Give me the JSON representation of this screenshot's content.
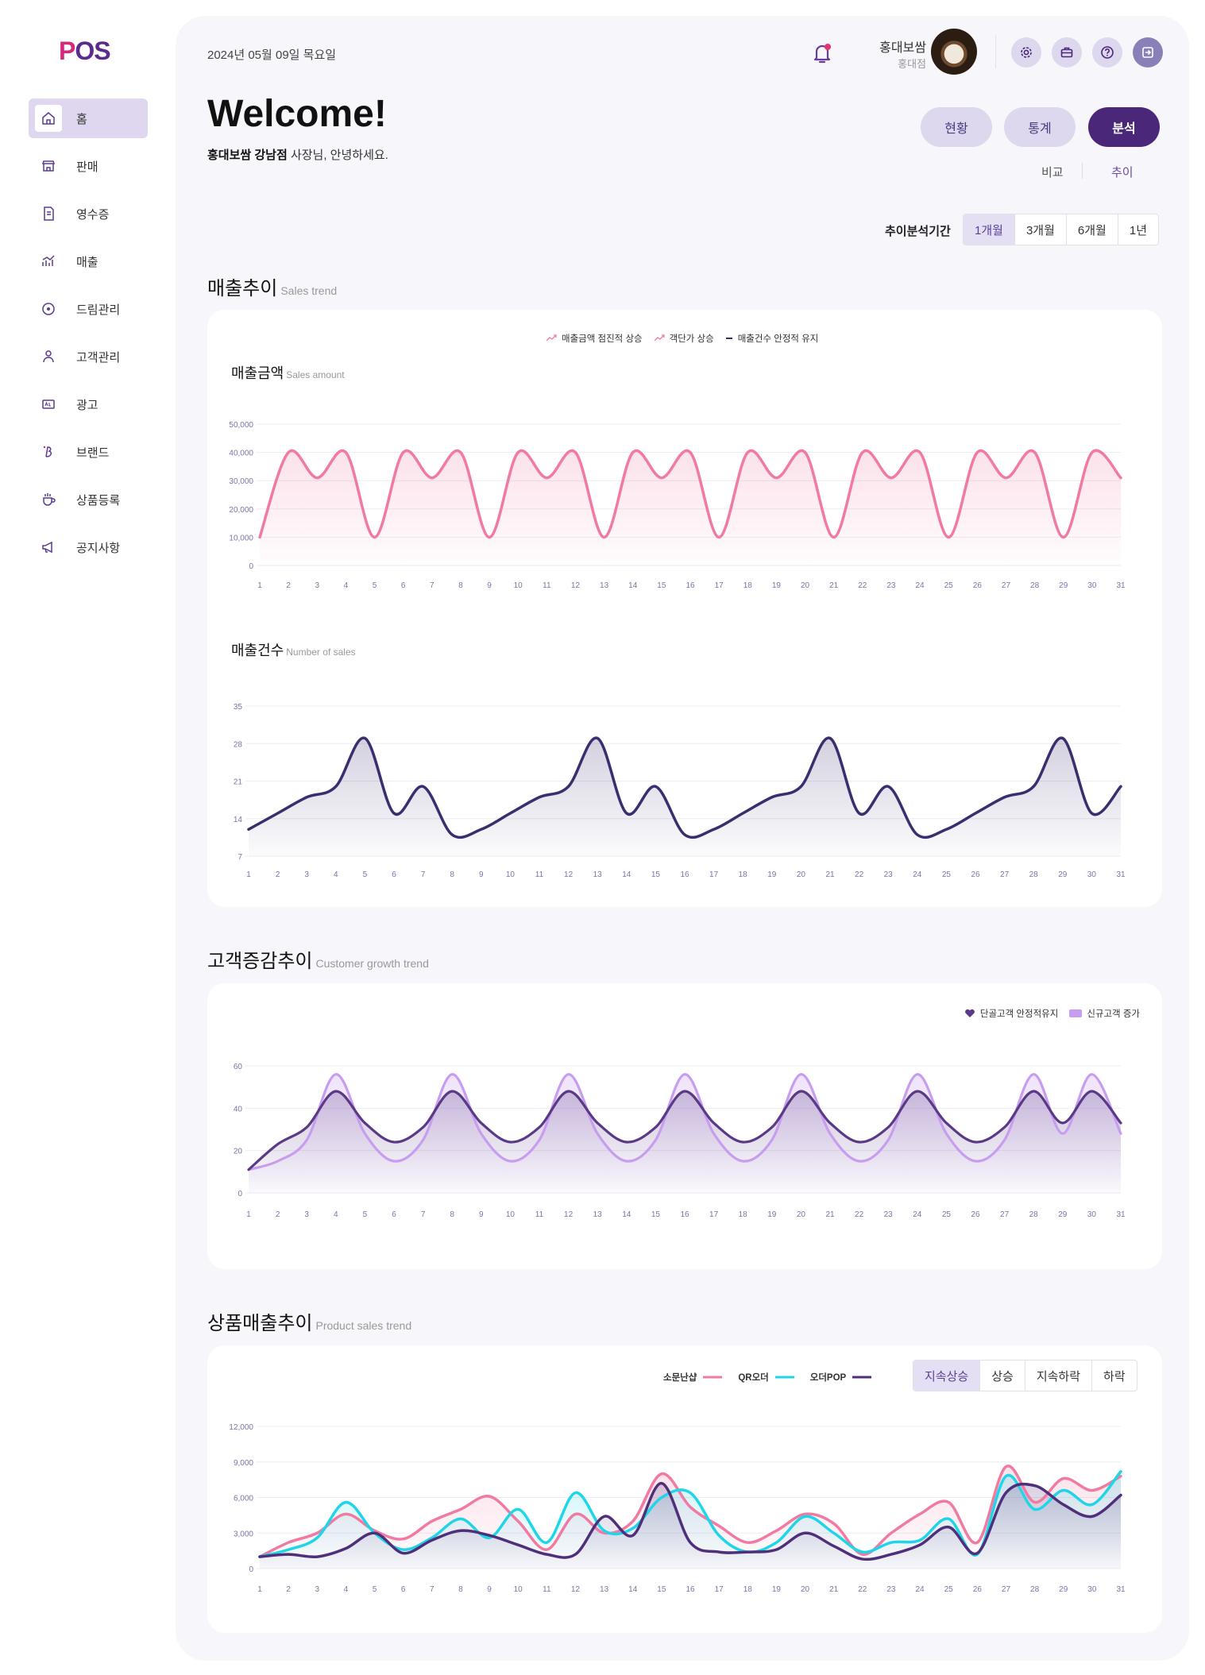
{
  "brand": {
    "logo_p": "P",
    "logo_rest": "OS",
    "accent": "#d6287a",
    "primary": "#4a2779"
  },
  "sidebar": {
    "items": [
      {
        "label": "홈",
        "icon": "home-icon",
        "active": true
      },
      {
        "label": "판매",
        "icon": "store-icon",
        "active": false
      },
      {
        "label": "영수증",
        "icon": "receipt-icon",
        "active": false
      },
      {
        "label": "매출",
        "icon": "trend-icon",
        "active": false
      },
      {
        "label": "드림관리",
        "icon": "coin-icon",
        "active": false
      },
      {
        "label": "고객관리",
        "icon": "person-icon",
        "active": false
      },
      {
        "label": "광고",
        "icon": "ad-icon",
        "active": false
      },
      {
        "label": "브랜드",
        "icon": "brand-icon",
        "active": false
      },
      {
        "label": "상품등록",
        "icon": "cup-icon",
        "active": false
      },
      {
        "label": "공지사항",
        "icon": "megaphone-icon",
        "active": false
      }
    ]
  },
  "header": {
    "date": "2024년 05월 09일 목요일",
    "user_name": "홍대보쌈",
    "user_store": "홍대점",
    "icons": [
      "gear-icon",
      "briefcase-icon",
      "help-icon",
      "logout-icon"
    ]
  },
  "welcome": {
    "title": "Welcome!",
    "store_bold": "홍대보쌈 강남점",
    "greeting_rest": " 사장님, 안녕하세요."
  },
  "view_tabs": [
    {
      "label": "현황",
      "active": false
    },
    {
      "label": "통계",
      "active": false
    },
    {
      "label": "분석",
      "active": true
    }
  ],
  "sub_tabs": [
    {
      "label": "비교",
      "active": false
    },
    {
      "label": "추이",
      "active": true
    }
  ],
  "period": {
    "label": "추이분석기간",
    "options": [
      {
        "label": "1개월",
        "active": true
      },
      {
        "label": "3개월",
        "active": false
      },
      {
        "label": "6개월",
        "active": false
      },
      {
        "label": "1년",
        "active": false
      }
    ]
  },
  "sections": {
    "sales": {
      "title": "매출추이",
      "en": "Sales trend"
    },
    "customer": {
      "title": "고객증감추이",
      "en": "Customer growth trend"
    },
    "product": {
      "title": "상품매출추이",
      "en": "Product sales trend"
    }
  },
  "sales_legend": [
    {
      "label": "매출금액 점진적 상승",
      "color": "#f07aa2",
      "marker": "trend-up"
    },
    {
      "label": "객단가 상승",
      "color": "#f07aa2",
      "marker": "trend-up"
    },
    {
      "label": "매출건수 안정적 유지",
      "color": "#3b2d6e",
      "marker": "dash"
    }
  ],
  "customer_legend": [
    {
      "label": "단골고객 안정적유지",
      "color": "#5a3a86",
      "marker": "heart"
    },
    {
      "label": "신규고객 증가",
      "color": "#c79df0",
      "marker": "new-badge"
    }
  ],
  "product_legend": [
    {
      "label": "소문난샵",
      "color": "#f07aa2"
    },
    {
      "label": "QR오더",
      "color": "#1fd6e8"
    },
    {
      "label": "오더POP",
      "color": "#4f2f7a"
    }
  ],
  "product_filter": [
    {
      "label": "지속상승",
      "active": true
    },
    {
      "label": "상승",
      "active": false
    },
    {
      "label": "지속하락",
      "active": false
    },
    {
      "label": "하락",
      "active": false
    }
  ],
  "chart_data": [
    {
      "id": "sales_amount",
      "type": "area",
      "title": "매출금액",
      "subtitle": "Sales amount",
      "x": [
        1,
        2,
        3,
        4,
        5,
        6,
        7,
        8,
        9,
        10,
        11,
        12,
        13,
        14,
        15,
        16,
        17,
        18,
        19,
        20,
        21,
        22,
        23,
        24,
        25,
        26,
        27,
        28,
        29,
        30,
        31
      ],
      "ylim": [
        0,
        50000
      ],
      "yticks": [
        0,
        10000,
        20000,
        30000,
        40000,
        50000
      ],
      "ytick_labels": [
        "0",
        "10,000",
        "20,000",
        "30,000",
        "40,000",
        "50,000"
      ],
      "grid": true,
      "series": [
        {
          "values": [
            10000,
            40000,
            31000,
            40000,
            10000,
            40000,
            31000,
            40000,
            10000,
            40000,
            31000,
            40000,
            10000,
            40000,
            31000,
            40000,
            10000,
            40000,
            31000,
            40000,
            10000,
            40000,
            31000,
            40000,
            10000,
            40000,
            31000,
            40000,
            10000,
            40000,
            31000
          ],
          "color": "#f07aa2"
        }
      ]
    },
    {
      "id": "sales_count",
      "type": "area",
      "title": "매출건수",
      "subtitle": "Number of sales",
      "x": [
        1,
        2,
        3,
        4,
        5,
        6,
        7,
        8,
        9,
        10,
        11,
        12,
        13,
        14,
        15,
        16,
        17,
        18,
        19,
        20,
        21,
        22,
        23,
        24,
        25,
        26,
        27,
        28,
        29,
        30,
        31
      ],
      "ylim": [
        7,
        35
      ],
      "yticks": [
        7,
        14,
        21,
        28,
        35
      ],
      "ytick_labels": [
        "7",
        "14",
        "21",
        "28",
        "35"
      ],
      "grid": true,
      "series": [
        {
          "values": [
            12,
            15,
            18,
            20,
            29,
            15,
            20,
            11,
            12,
            15,
            18,
            20,
            29,
            15,
            20,
            11,
            12,
            15,
            18,
            20,
            29,
            15,
            20,
            11,
            12,
            15,
            18,
            20,
            29,
            15,
            20
          ],
          "color": "#3b2d6e"
        }
      ]
    },
    {
      "id": "customer",
      "type": "area",
      "x": [
        1,
        2,
        3,
        4,
        5,
        6,
        7,
        8,
        9,
        10,
        11,
        12,
        13,
        14,
        15,
        16,
        17,
        18,
        19,
        20,
        21,
        22,
        23,
        24,
        25,
        26,
        27,
        28,
        29,
        30,
        31
      ],
      "ylim": [
        0,
        60
      ],
      "yticks": [
        0,
        20,
        40,
        60
      ],
      "ytick_labels": [
        "0",
        "20",
        "40",
        "60"
      ],
      "grid": true,
      "series": [
        {
          "values": [
            11,
            15,
            25,
            56,
            28,
            15,
            25,
            56,
            28,
            15,
            25,
            56,
            28,
            15,
            25,
            56,
            28,
            15,
            25,
            56,
            28,
            15,
            25,
            56,
            28,
            15,
            25,
            56,
            28,
            56,
            28
          ],
          "color": "#c79df0"
        },
        {
          "values": [
            11,
            23,
            31,
            48,
            33,
            24,
            31,
            48,
            33,
            24,
            31,
            48,
            33,
            24,
            31,
            48,
            33,
            24,
            31,
            48,
            33,
            24,
            31,
            48,
            33,
            24,
            31,
            48,
            33,
            48,
            33
          ],
          "color": "#5a3a86"
        }
      ]
    },
    {
      "id": "product",
      "type": "area",
      "x": [
        1,
        2,
        3,
        4,
        5,
        6,
        7,
        8,
        9,
        10,
        11,
        12,
        13,
        14,
        15,
        16,
        17,
        18,
        19,
        20,
        21,
        22,
        23,
        24,
        25,
        26,
        27,
        28,
        29,
        30,
        31
      ],
      "ylim": [
        0,
        12000
      ],
      "yticks": [
        0,
        3000,
        6000,
        9000,
        12000
      ],
      "ytick_labels": [
        "0",
        "3,000",
        "6,000",
        "9,000",
        "12,000"
      ],
      "grid": true,
      "series": [
        {
          "name": "소문난샵",
          "values": [
            1000,
            2200,
            3000,
            4600,
            3200,
            2500,
            4000,
            5000,
            6100,
            4000,
            1600,
            4600,
            3000,
            4000,
            8000,
            5200,
            3600,
            2200,
            3200,
            4600,
            3800,
            1200,
            3000,
            4600,
            5600,
            2200,
            8600,
            5600,
            7600,
            6600,
            7800
          ],
          "color": "#f07aa2"
        },
        {
          "name": "QR오더",
          "values": [
            1000,
            1600,
            2600,
            5600,
            3000,
            1600,
            2600,
            4200,
            2600,
            5000,
            2200,
            6400,
            3200,
            3400,
            6000,
            6400,
            2800,
            1400,
            2200,
            4400,
            3000,
            1400,
            2200,
            2400,
            4200,
            1200,
            7800,
            5000,
            6600,
            5400,
            8200
          ],
          "color": "#1fd6e8"
        },
        {
          "name": "오더POP",
          "values": [
            1000,
            1200,
            1000,
            1700,
            3000,
            1300,
            2400,
            3200,
            2800,
            2000,
            1200,
            1200,
            4400,
            2800,
            7200,
            2200,
            1400,
            1400,
            1600,
            3000,
            1900,
            800,
            1200,
            2000,
            3500,
            1300,
            6400,
            7000,
            5400,
            4400,
            6200
          ],
          "color": "#4f2f7a"
        }
      ]
    }
  ]
}
